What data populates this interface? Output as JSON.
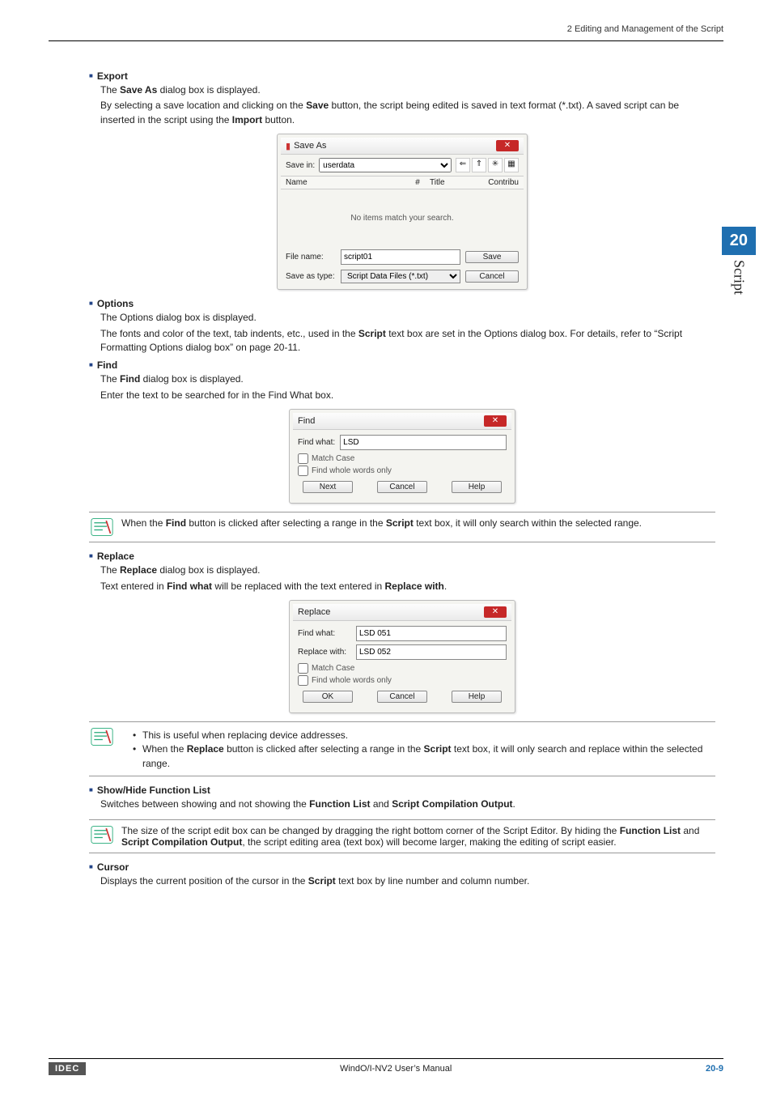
{
  "header": {
    "breadcrumb": "2 Editing and Management of the Script"
  },
  "sideTab": {
    "number": "20",
    "label": "Script"
  },
  "export": {
    "title": "Export",
    "p1_a": "The ",
    "p1_b": "Save As",
    "p1_c": " dialog box is displayed.",
    "p2_a": "By selecting a save location and clicking on the ",
    "p2_b": "Save",
    "p2_c": " button, the script being edited is saved in text format (*.txt). A saved script can be inserted in the script using the ",
    "p2_d": "Import",
    "p2_e": " button."
  },
  "saveAsDlg": {
    "title": "Save As",
    "saveInLabel": "Save in:",
    "folder": "userdata",
    "cols": {
      "name": "Name",
      "hash": "#",
      "titleCol": "Title",
      "contrib": "Contribu"
    },
    "empty": "No items match your search.",
    "fileNameLabel": "File name:",
    "fileName": "script01",
    "saveTypeLabel": "Save as type:",
    "saveType": "Script Data Files (*.txt)",
    "saveBtn": "Save",
    "cancelBtn": "Cancel"
  },
  "options": {
    "title": "Options",
    "p1": "The Options dialog box is displayed.",
    "p2_a": "The fonts and color of the text, tab indents, etc., used in the ",
    "p2_b": "Script",
    "p2_c": " text box are set in the Options dialog box. For details, refer to “Script Formatting Options dialog box” on page 20-11."
  },
  "find": {
    "title": "Find",
    "p1_a": "The ",
    "p1_b": "Find",
    "p1_c": " dialog box is displayed.",
    "p2": "Enter the text to be searched for in the Find What box."
  },
  "findDlg": {
    "title": "Find",
    "findWhatLabel": "Find what:",
    "findWhat": "LSD",
    "matchCase": "Match Case",
    "whole": "Find whole words only",
    "next": "Next",
    "cancel": "Cancel",
    "help": "Help"
  },
  "findNote": {
    "a": "When the ",
    "b": "Find",
    "c": " button is clicked after selecting a range in the ",
    "d": "Script",
    "e": " text box, it will only search within the selected range."
  },
  "replace": {
    "title": "Replace",
    "p1_a": "The ",
    "p1_b": "Replace",
    "p1_c": " dialog box is displayed.",
    "p2_a": "Text entered in ",
    "p2_b": "Find what",
    "p2_c": " will be replaced with the text entered in ",
    "p2_d": "Replace with",
    "p2_e": "."
  },
  "replaceDlg": {
    "title": "Replace",
    "findWhatLabel": "Find what:",
    "findWhat": "LSD 051",
    "replaceWithLabel": "Replace with:",
    "replaceWith": "LSD 052",
    "matchCase": "Match Case",
    "whole": "Find whole words only",
    "ok": "OK",
    "cancel": "Cancel",
    "help": "Help"
  },
  "replaceNote": {
    "li1": "This is useful when replacing device addresses.",
    "li2_a": "When the ",
    "li2_b": "Replace",
    "li2_c": " button is clicked after selecting a range in the ",
    "li2_d": "Script",
    "li2_e": " text box, it will only search and replace within the selected range."
  },
  "showHide": {
    "title": "Show/Hide Function List",
    "p_a": "Switches between showing and not showing the ",
    "p_b": "Function List",
    "p_c": " and ",
    "p_d": "Script Compilation Output",
    "p_e": "."
  },
  "showHideNote": {
    "a": "The size of the script edit box can be changed by dragging the right bottom corner of the Script Editor. By hiding the ",
    "b": "Function List",
    "c": " and ",
    "d": "Script Compilation Output",
    "e": ", the script editing area (text box) will become larger, making the editing of script easier."
  },
  "cursor": {
    "title": "Cursor",
    "p_a": "Displays the current position of the cursor in the ",
    "p_b": "Script",
    "p_c": " text box by line number and column number."
  },
  "footer": {
    "logo": "IDEC",
    "center": "WindO/I-NV2 User’s Manual",
    "page": "20-9"
  }
}
